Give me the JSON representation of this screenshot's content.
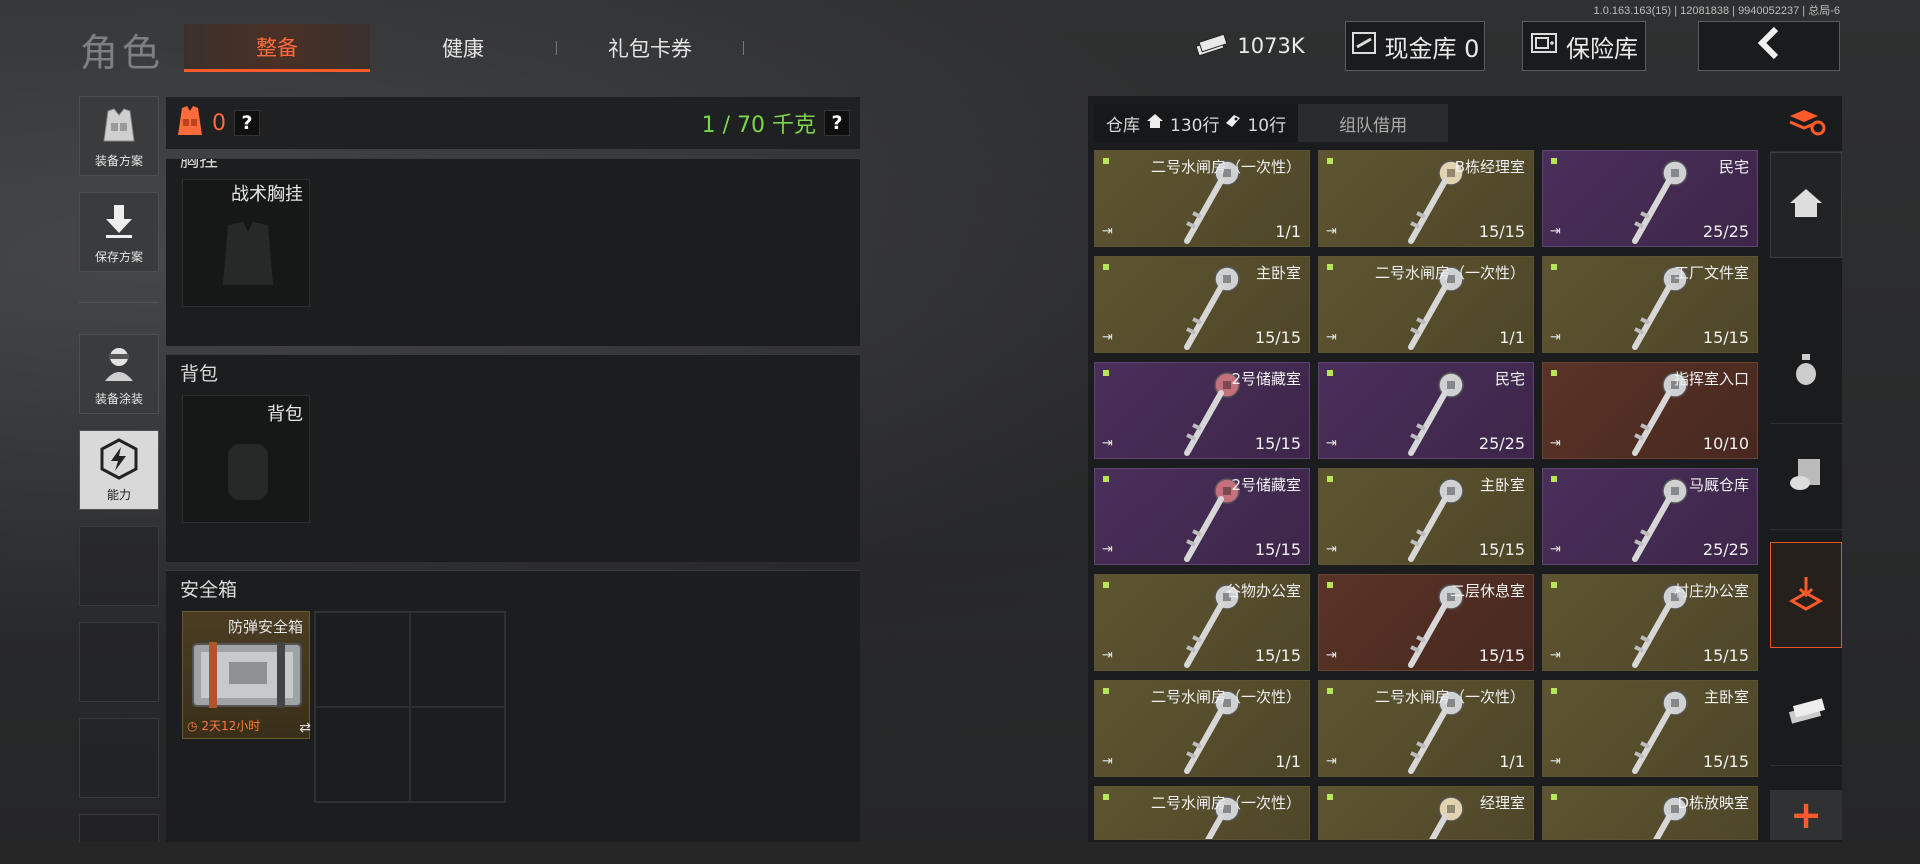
{
  "version": "1.0.163.163(15) | 12081838 | 9940052237 | 总局-6",
  "header": {
    "title": "角色",
    "tabs": [
      {
        "label": "整备",
        "active": true
      },
      {
        "label": "健康",
        "active": false
      },
      {
        "label": "礼包卡券",
        "active": false
      }
    ],
    "money": "1073K",
    "cash_vault": "现金库 0",
    "safe_vault": "保险库",
    "back_icon": "chevron-left-icon"
  },
  "left_sidebar": {
    "items": [
      {
        "label": "装备方案",
        "icon": "vest-icon"
      },
      {
        "label": "保存方案",
        "icon": "download-icon"
      },
      {
        "label": "装备涂装",
        "icon": "soldier-icon"
      },
      {
        "label": "能力",
        "icon": "lightning-hex-icon",
        "active": true
      }
    ]
  },
  "equipment": {
    "armor_count": "0",
    "help": "?",
    "weight": "1 / 70 千克",
    "sections": {
      "chest_rig": {
        "title": "胸挂",
        "slot_label": "战术胸挂"
      },
      "backpack": {
        "title": "背包",
        "slot_label": "背包"
      },
      "secure": {
        "title": "安全箱",
        "slot_label": "防弹安全箱",
        "timer": "2天12小时",
        "swap": "⇄"
      }
    }
  },
  "warehouse": {
    "tab_label": "仓库",
    "rows_total": "130行",
    "rows_keys": "10行",
    "team_tab": "组队借用",
    "items": [
      {
        "name": "二号水闸房（一次性）",
        "qty": "1/1",
        "color": "gold"
      },
      {
        "name": "B栋经理室",
        "qty": "15/15",
        "color": "gold"
      },
      {
        "name": "民宅",
        "qty": "25/25",
        "color": "purple"
      },
      {
        "name": "主卧室",
        "qty": "15/15",
        "color": "gold"
      },
      {
        "name": "二号水闸房（一次性）",
        "qty": "1/1",
        "color": "gold"
      },
      {
        "name": "工厂文件室",
        "qty": "15/15",
        "color": "gold"
      },
      {
        "name": "2号储藏室",
        "qty": "15/15",
        "color": "purple"
      },
      {
        "name": "民宅",
        "qty": "25/25",
        "color": "purple"
      },
      {
        "name": "指挥室入口",
        "qty": "10/10",
        "color": "red"
      },
      {
        "name": "2号储藏室",
        "qty": "15/15",
        "color": "purple"
      },
      {
        "name": "主卧室",
        "qty": "15/15",
        "color": "gold"
      },
      {
        "name": "马厩仓库",
        "qty": "25/25",
        "color": "purple"
      },
      {
        "name": "谷物办公室",
        "qty": "15/15",
        "color": "gold"
      },
      {
        "name": "二层休息室",
        "qty": "15/15",
        "color": "red"
      },
      {
        "name": "村庄办公室",
        "qty": "15/15",
        "color": "gold"
      },
      {
        "name": "二号水闸房（一次性）",
        "qty": "1/1",
        "color": "gold"
      },
      {
        "name": "二号水闸房（一次性）",
        "qty": "1/1",
        "color": "gold"
      },
      {
        "name": "主卧室",
        "qty": "15/15",
        "color": "gold"
      },
      {
        "name": "二号水闸房（一次性）",
        "qty": "",
        "color": "gold"
      },
      {
        "name": "经理室",
        "qty": "",
        "color": "gold"
      },
      {
        "name": "D栋放映室",
        "qty": "",
        "color": "gold"
      }
    ]
  },
  "right_rail": {
    "icons": [
      "layers-refresh-icon",
      "home-icon",
      "grenade-icon",
      "accessory-icon",
      "key-drop-icon",
      "cash-icon"
    ],
    "plus": "+"
  }
}
